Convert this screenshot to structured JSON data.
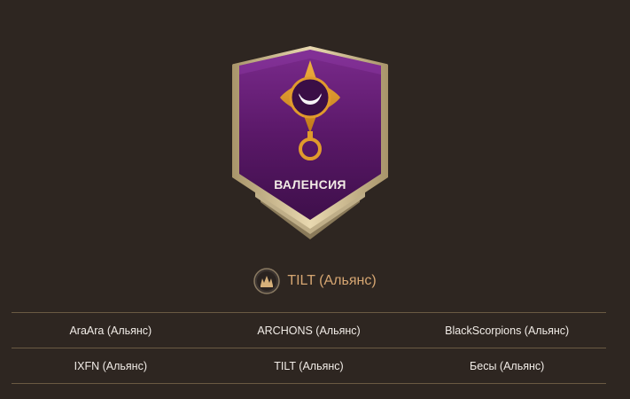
{
  "territory": {
    "name": "ВАЛЕНСИЯ",
    "emblem_icon": "crescent-moon-eye-emblem",
    "banner_color": "#5c1a6a",
    "frame_color": "#c8b48c"
  },
  "owner": {
    "label": "TILT (Альянс)",
    "icon": "alliance-crest-icon",
    "label_color": "#d6a672"
  },
  "alliances": {
    "rows": [
      [
        "AraAra (Альянс)",
        "ARCHONS (Альянс)",
        "BlackScorpions (Альянс)"
      ],
      [
        "IXFN (Альянс)",
        "TILT (Альянс)",
        "Бесы (Альянс)"
      ]
    ]
  }
}
